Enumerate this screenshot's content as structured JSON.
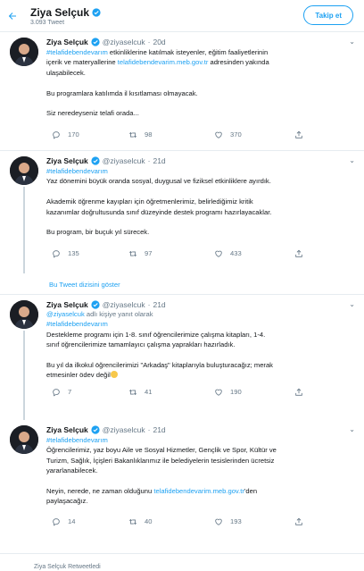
{
  "header": {
    "name": "Ziya Selçuk",
    "tweet_count": "3.093 Tweet",
    "follow_label": "Takip et"
  },
  "colors": {
    "accent": "#1da1f2",
    "muted": "#657786",
    "border": "#e6ecf0"
  },
  "tweets": [
    {
      "name": "Ziya Selçuk",
      "handle": "@ziyaselcuk",
      "sep": "·",
      "time": "20d",
      "lines": [
        [
          "#telafidebendevarım",
          " etkinliklerine katılmak isteyenler, eğitim faaliyetlerinin"
        ],
        [
          "içerik ve materyallerine ",
          "telafidebendevarim.meb.gov.tr",
          " adresinden yakında"
        ],
        [
          "ulaşabilecek."
        ],
        [
          "Bu programlara katılımda il kısıtlaması olmayacak."
        ],
        [
          "Siz neredeyseniz telafi orada..."
        ]
      ],
      "reply": "170",
      "retweet": "98",
      "like": "370"
    },
    {
      "name": "Ziya Selçuk",
      "handle": "@ziyaselcuk",
      "sep": "·",
      "time": "21d",
      "lines": [
        [
          "#telafidebendevarım"
        ],
        [
          "Yaz dönemini büyük oranda sosyal, duygusal ve fiziksel etkinliklere ayırdık."
        ],
        [
          "Akademik öğrenme kayıpları için öğretmenlerimiz, belirlediğimiz kritik"
        ],
        [
          "kazanımlar doğrultusunda sınıf düzeyinde destek programı hazırlayacaklar."
        ],
        [
          "Bu program, bir buçuk yıl sürecek."
        ]
      ],
      "reply": "135",
      "retweet": "97",
      "like": "433"
    },
    {
      "name": "Ziya Selçuk",
      "handle": "@ziyaselcuk",
      "sep": "·",
      "time": "21d",
      "reply_to": [
        "@ziyaselcuk",
        " adlı kişiye yanıt olarak"
      ],
      "lines": [
        [
          "#telafidebendevarım"
        ],
        [
          "Destekleme programı için 1-8. sınıf öğrencilerimize çalışma kitapları, 1-4."
        ],
        [
          "sınıf öğrencilerimize tamamlayıcı çalışma yaprakları hazırladık."
        ],
        [
          "Bu yıl da ilkokul öğrencilerimizi \"Arkadaş\" kitaplarıyla buluşturacağız; merak"
        ],
        [
          "etmesinler ödev değil"
        ]
      ],
      "reply": "7",
      "retweet": "41",
      "like": "190"
    },
    {
      "name": "Ziya Selçuk",
      "handle": "@ziyaselcuk",
      "sep": "·",
      "time": "21d",
      "lines": [
        [
          "#telafidebendevarım"
        ],
        [
          "Öğrencilerimiz, yaz boyu Aile ve Sosyal Hizmetler, Gençlik ve Spor, Kültür ve"
        ],
        [
          "Turizm, Sağlık, İçişleri Bakanlıklarımız ile belediyelerin tesislerinden ücretsiz"
        ],
        [
          "yararlanabilecek."
        ],
        [
          "Neyin, nerede, ne zaman olduğunu ",
          "telafidebendevarim.meb.gov.tr",
          "'den"
        ],
        [
          "paylaşacağız."
        ]
      ],
      "reply": "14",
      "retweet": "40",
      "like": "193"
    }
  ],
  "show_thread": "Bu Tweet dizisini göster",
  "footer_peek": "Ziya Selçuk Retweetledi"
}
